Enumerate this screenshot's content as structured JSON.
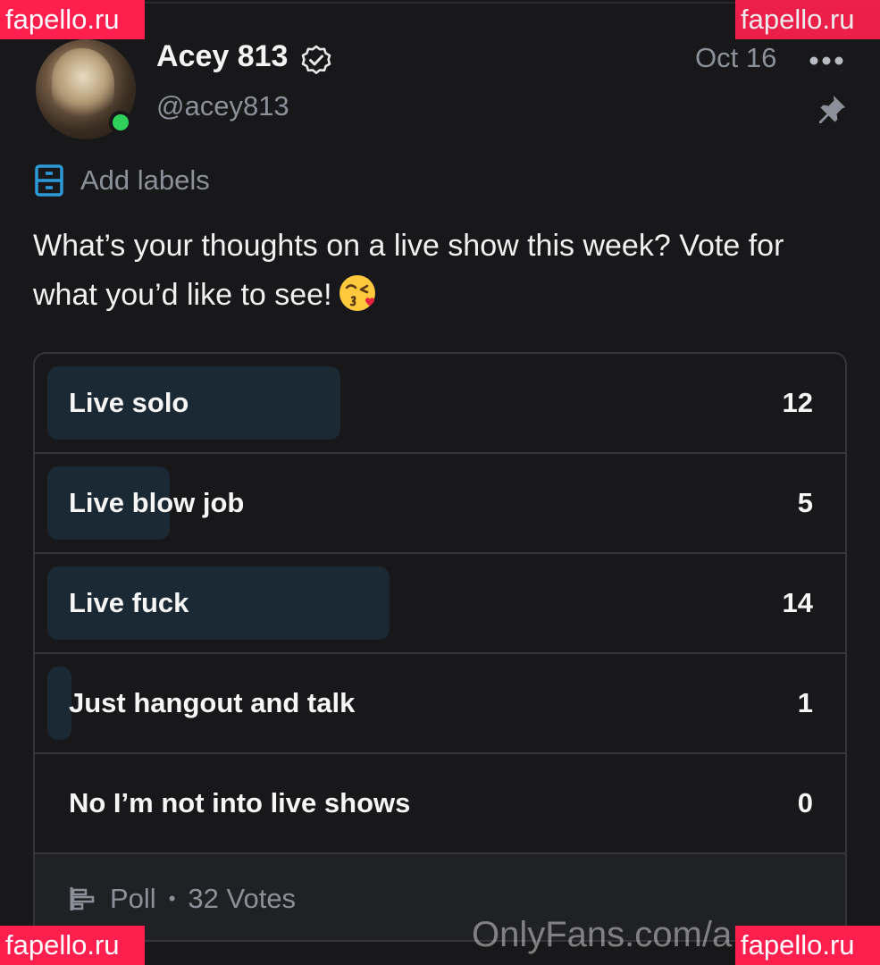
{
  "post": {
    "display_name": "Acey 813",
    "handle": "@acey813",
    "date": "Oct 16",
    "add_labels": "Add labels",
    "text": "What’s your thoughts on a live show this week? Vote for what you’d like to see!",
    "emoji": "kissing-face-with-heart-icon"
  },
  "poll": {
    "options": [
      {
        "label": "Live solo",
        "count": "12",
        "fraction": 0.375
      },
      {
        "label": "Live blow job",
        "count": "5",
        "fraction": 0.156
      },
      {
        "label": "Live fuck",
        "count": "14",
        "fraction": 0.4375
      },
      {
        "label": "Just hangout and talk",
        "count": "1",
        "fraction": 0.03125
      },
      {
        "label": "No I’m not into live shows",
        "count": "0",
        "fraction": 0
      }
    ],
    "footer_type": "Poll",
    "footer_separator": "•",
    "footer_votes": "32 Votes"
  },
  "overlays": {
    "watermark": "OnlyFans.com/a",
    "badge": "fapello.ru"
  },
  "colors": {
    "background": "#18181a",
    "online": "#2fd15a",
    "accent_blue": "#2c9ad8",
    "poll_fill": "#1a2933",
    "badge": "#ff1f4f"
  }
}
